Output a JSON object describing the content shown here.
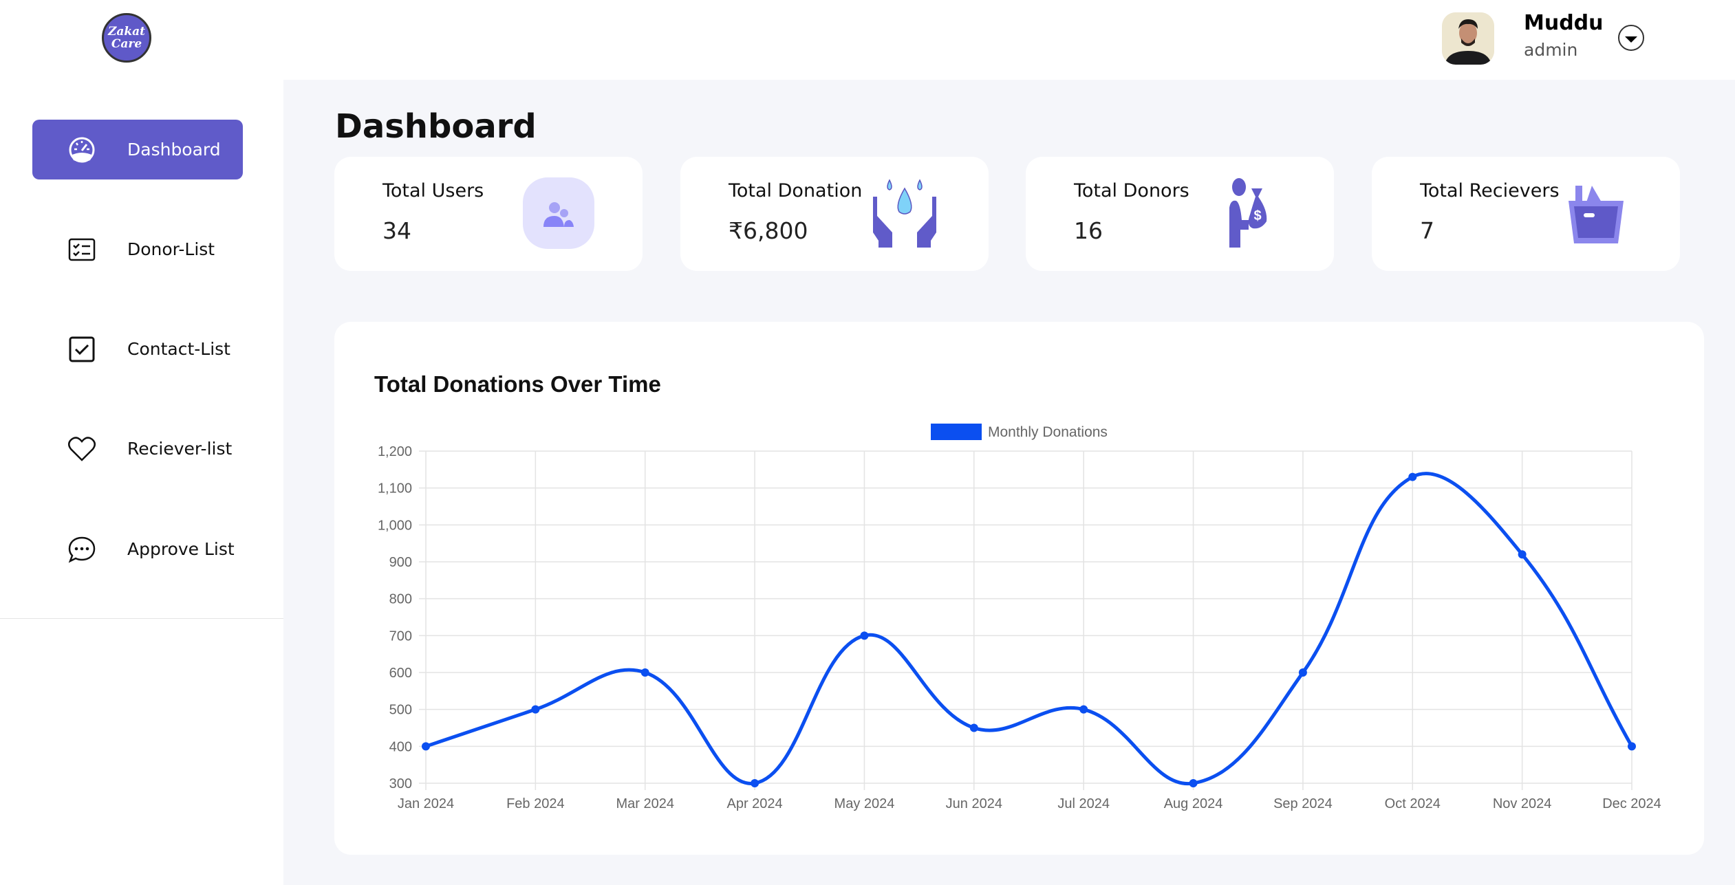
{
  "brand": {
    "logo_text_1": "Zakat",
    "logo_text_2": "Care"
  },
  "user": {
    "name": "Muddu",
    "role": "admin"
  },
  "sidebar": {
    "items": [
      {
        "label": "Dashboard",
        "icon": "speedometer-icon",
        "active": true
      },
      {
        "label": "Donor-List",
        "icon": "checklist-icon"
      },
      {
        "label": "Contact-List",
        "icon": "checkbox-icon"
      },
      {
        "label": "Reciever-list",
        "icon": "heart-icon"
      },
      {
        "label": "Approve List",
        "icon": "chat-icon"
      }
    ]
  },
  "page": {
    "title": "Dashboard"
  },
  "stats": [
    {
      "label": "Total Users",
      "value": "34",
      "icon": "users-icon"
    },
    {
      "label": "Total Donation",
      "value": "₹6,800",
      "icon": "hands-water-icon"
    },
    {
      "label": "Total Donors",
      "value": "16",
      "icon": "donor-money-bag-icon"
    },
    {
      "label": "Total Recievers",
      "value": "7",
      "icon": "basket-icon"
    }
  ],
  "colors": {
    "accent": "#605bc9",
    "line": "#0b4ff0",
    "background": "#f5f6fa"
  },
  "chart_data": {
    "type": "line",
    "title": "Total Donations Over Time",
    "categories": [
      "Jan 2024",
      "Feb 2024",
      "Mar 2024",
      "Apr 2024",
      "May 2024",
      "Jun 2024",
      "Jul 2024",
      "Aug 2024",
      "Sep 2024",
      "Oct 2024",
      "Nov 2024",
      "Dec 2024"
    ],
    "series": [
      {
        "name": "Monthly Donations",
        "values": [
          400,
          500,
          600,
          300,
          700,
          450,
          500,
          300,
          600,
          1130,
          920,
          400
        ]
      }
    ],
    "ylim": [
      300,
      1200
    ],
    "yticks": [
      "300",
      "400",
      "500",
      "600",
      "700",
      "800",
      "900",
      "1,000",
      "1,100",
      "1,200"
    ],
    "grid": true,
    "legend": "top",
    "smooth": true
  }
}
